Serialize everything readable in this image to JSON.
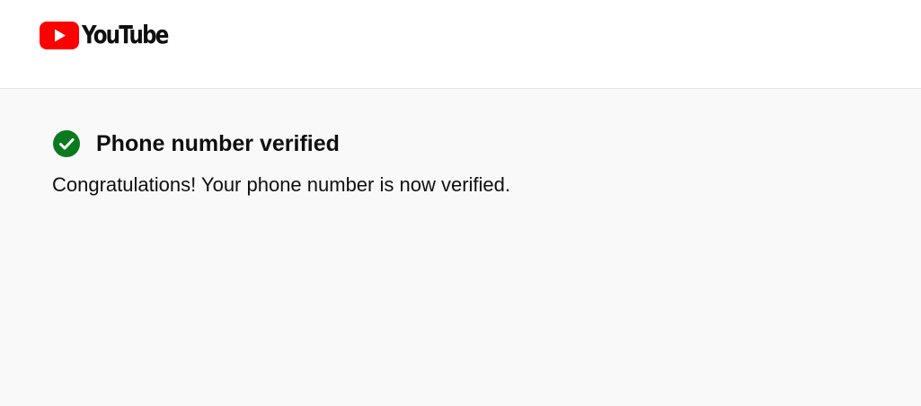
{
  "header": {
    "logo_text": "YouTube",
    "logo_icon": "youtube-play-icon",
    "brand_color": "#ff0000"
  },
  "verification": {
    "icon": "check-circle-icon",
    "icon_color": "#0b7a1f",
    "title": "Phone number verified",
    "message": "Congratulations! Your phone number is now verified."
  }
}
